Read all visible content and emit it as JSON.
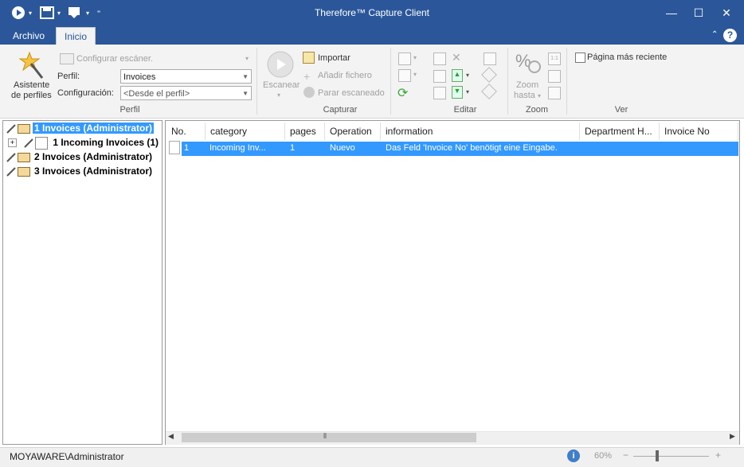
{
  "window": {
    "title": "Therefore™ Capture Client"
  },
  "tabs": [
    {
      "label": "Archivo"
    },
    {
      "label": "Inicio"
    }
  ],
  "ribbon": {
    "perfil": {
      "wizard_label_line1": "Asistente",
      "wizard_label_line2": "de perfiles",
      "configure_scanner": "Configurar escáner.",
      "profile_label": "Perfil:",
      "profile_value": "Invoices",
      "config_label": "Configuración:",
      "config_value": "<Desde el perfil>",
      "group_label": "Perfil"
    },
    "capturar": {
      "scan_label": "Escanear",
      "import_label": "Importar",
      "add_file_label": "Añadir fichero",
      "stop_scan_label": "Parar escaneado",
      "group_label": "Capturar"
    },
    "editar": {
      "group_label": "Editar"
    },
    "zoom": {
      "zoom_to_line1": "Zoom",
      "zoom_to_line2": "hasta",
      "group_label": "Zoom"
    },
    "ver": {
      "recent_page_label": "Página más reciente",
      "group_label": "Ver"
    }
  },
  "tree": {
    "items": [
      {
        "label": "1 Invoices (Administrator)"
      },
      {
        "label": "1 Incoming Invoices (1)"
      },
      {
        "label": "2 Invoices (Administrator)"
      },
      {
        "label": "3 Invoices (Administrator)"
      }
    ]
  },
  "list": {
    "columns": [
      "No.",
      "category",
      "pages",
      "Operation",
      "information",
      "Department H...",
      "Invoice No"
    ],
    "rows": [
      {
        "no": "1",
        "category": "Incoming Inv...",
        "pages": "1",
        "operation": "Nuevo",
        "information": "Das Feld 'Invoice No' benötigt eine Eingabe."
      }
    ]
  },
  "status": {
    "user": "MOYAWARE\\Administrator",
    "zoom": "60%",
    "minus": "−",
    "plus": "+"
  },
  "colors": {
    "title_bar": "#2b579a",
    "selection": "#3399ff"
  }
}
